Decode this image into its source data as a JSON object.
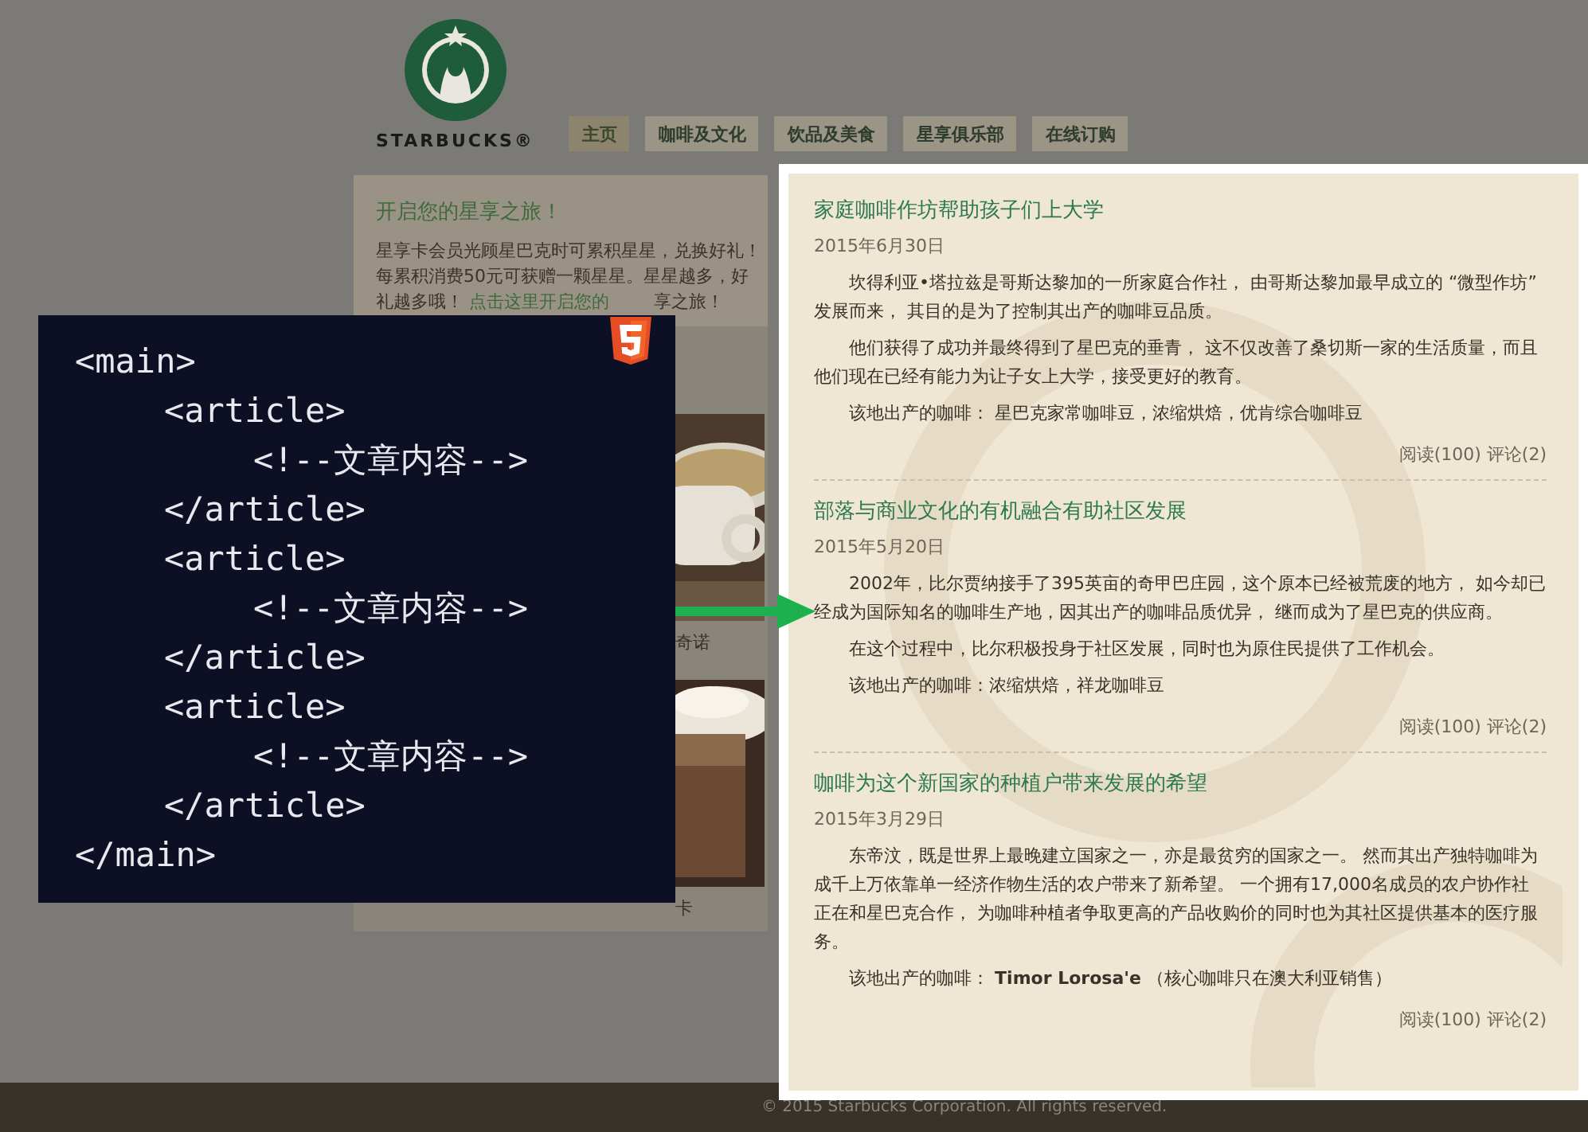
{
  "header": {
    "logo_text": "STARBUCKS®",
    "nav": [
      {
        "label": "主页",
        "selected": true
      },
      {
        "label": "咖啡及文化",
        "selected": false
      },
      {
        "label": "饮品及美食",
        "selected": false
      },
      {
        "label": "星享俱乐部",
        "selected": false
      },
      {
        "label": "在线订购",
        "selected": false
      }
    ]
  },
  "sidebar": {
    "title": "开启您的星享之旅！",
    "text": "星享卡会员光顾星巴克时可累积星星，兑换好礼！每累积消费50元可获赠一颗星星。星星越多，好礼越多哦！",
    "link": "点击这里开启您的",
    "text_after": "享之旅！",
    "products": [
      {
        "kind": "picture",
        "caption": "奇诺"
      },
      {
        "kind": "picture",
        "caption": "卡"
      }
    ]
  },
  "articles": [
    {
      "title": "家庭咖啡作坊帮助孩子们上大学",
      "date": "2015年6月30日",
      "paragraphs": [
        "坎得利亚•塔拉兹是哥斯达黎加的一所家庭合作社， 由哥斯达黎加最早成立的 “微型作坊” 发展而来， 其目的是为了控制其出产的咖啡豆品质。",
        "他们获得了成功并最终得到了星巴克的垂青， 这不仅改善了桑切斯一家的生活质量，而且他们现在已经有能力为让子女上大学，接受更好的教育。"
      ],
      "coffee": "该地出产的咖啡： 星巴克家常咖啡豆，浓缩烘焙，优肯综合咖啡豆",
      "stats": "阅读(100) 评论(2)"
    },
    {
      "title": "部落与商业文化的有机融合有助社区发展",
      "date": "2015年5月20日",
      "paragraphs": [
        "2002年，比尔贾纳接手了395英亩的奇甲巴庄园，这个原本已经被荒废的地方， 如今却已经成为国际知名的咖啡生产地，因其出产的咖啡品质优异， 继而成为了星巴克的供应商。",
        "在这个过程中，比尔积极投身于社区发展，同时也为原住民提供了工作机会。"
      ],
      "coffee": "该地出产的咖啡：浓缩烘焙，祥龙咖啡豆",
      "stats": "阅读(100) 评论(2)"
    },
    {
      "title": "咖啡为这个新国家的种植户带来发展的希望",
      "date": "2015年3月29日",
      "paragraphs": [
        "东帝汶，既是世界上最晚建立国家之一，亦是最贫穷的国家之一。 然而其出产独特咖啡为成千上万依靠单一经济作物生活的农户带来了新希望。 一个拥有17,000名成员的农户协作社正在和星巴克合作， 为咖啡种植者争取更高的产品收购价的同时也为其社区提供基本的医疗服务。"
      ],
      "coffee": "该地出产的咖啡： **Timor Lorosa'e** （核心咖啡只在澳大利亚销售）",
      "stats": "阅读(100) 评论(2)"
    }
  ],
  "code_overlay": {
    "lines": [
      {
        "open": "<main>",
        "close": "</main>",
        "children": [
          {
            "open": "<article>",
            "close": "</article>",
            "children": [
              {
                "open": "<!--文章内容-->"
              }
            ]
          },
          {
            "open": "<article>",
            "close": "</article>",
            "children": [
              {
                "open": "<!--文章内容-->"
              }
            ]
          },
          {
            "open": "<article>",
            "close": "</article>",
            "children": [
              {
                "open": "<!--文章内容-->"
              }
            ]
          }
        ]
      }
    ]
  },
  "footer": "© 2015 Starbucks Corporation. All rights reserved."
}
